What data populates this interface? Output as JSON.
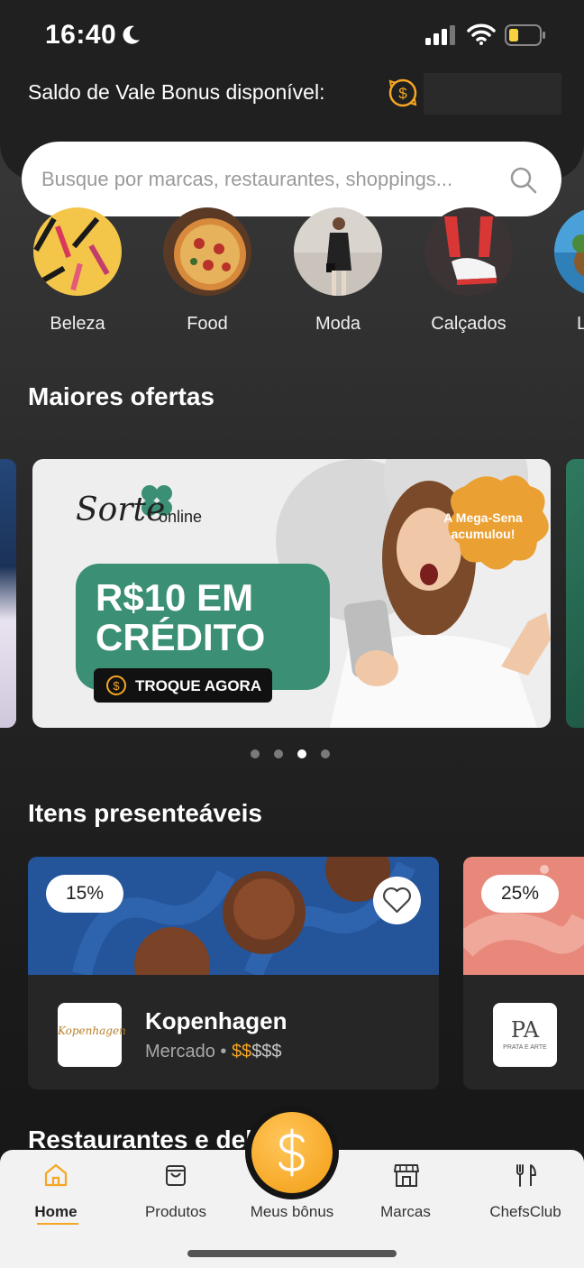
{
  "status_bar": {
    "time": "16:40"
  },
  "balance": {
    "label": "Saldo de Vale Bonus disponível:"
  },
  "search": {
    "placeholder": "Busque por marcas, restaurantes, shoppings..."
  },
  "categories": [
    {
      "label": "Beleza"
    },
    {
      "label": "Food"
    },
    {
      "label": "Moda"
    },
    {
      "label": "Calçados"
    },
    {
      "label": "L"
    }
  ],
  "offers": {
    "title": "Maiores ofertas",
    "banner": {
      "brand_script": "Sorte",
      "brand_word": "online",
      "badge": "A Mega-Sena acumulou!",
      "headline_line1": "R$10 EM",
      "headline_line2": "CRÉDITO",
      "cta": "TROQUE AGORA"
    },
    "page_count": 4,
    "active_page": 3
  },
  "gifts": {
    "title": "Itens presenteáveis",
    "cards": [
      {
        "discount": "15%",
        "name": "Kopenhagen",
        "logo_text": "Kopenhagen",
        "category": "Mercado",
        "price_active": "$$",
        "price_inactive": "$$$"
      },
      {
        "discount": "25%",
        "logo_text": "PRATA E ARTE"
      }
    ]
  },
  "next_section": {
    "title": "Restaurantes e deli"
  },
  "bottom_nav": {
    "items": [
      {
        "label": "Home",
        "icon": "home-icon",
        "active": true
      },
      {
        "label": "Produtos",
        "icon": "bag-icon"
      },
      {
        "label": "Meus bônus",
        "icon": "dollar-icon"
      },
      {
        "label": "Marcas",
        "icon": "store-icon"
      },
      {
        "label": "ChefsClub",
        "icon": "utensils-icon"
      }
    ]
  },
  "colors": {
    "accent": "#f5a623",
    "banner_green": "#3a8f74",
    "card_blue": "#24549a",
    "card_pink": "#e8887a"
  }
}
